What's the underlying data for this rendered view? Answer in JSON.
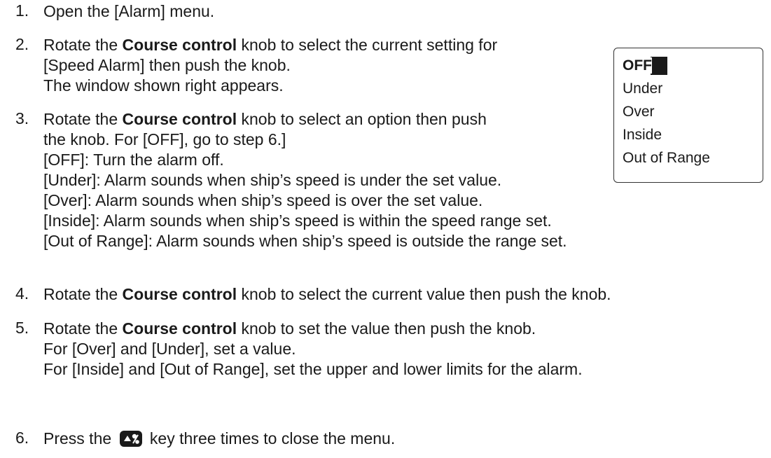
{
  "steps": [
    {
      "num": "1.",
      "lines": [
        "Open the [Alarm] menu."
      ]
    },
    {
      "num": "2.",
      "a": "Rotate the ",
      "bold": "Course control",
      "b": " knob to select the current setting for",
      "lines": [
        "[Speed Alarm] then push the knob.",
        "The window shown right appears."
      ]
    },
    {
      "num": "3.",
      "a": "Rotate the ",
      "bold": "Course control",
      "b": " knob to select an option then push",
      "lines": [
        "the knob. For [OFF], go to step 6.]",
        "[OFF]: Turn the alarm off.",
        "[Under]: Alarm sounds when ship’s speed is under the set value.",
        "[Over]: Alarm sounds when ship’s speed is over the set value.",
        "[Inside]: Alarm sounds when ship’s speed is within the speed range set.",
        "[Out of Range]: Alarm sounds when ship’s speed is outside the range set."
      ]
    },
    {
      "num": "4.",
      "a": "Rotate the ",
      "bold": "Course control",
      "b": " knob to select the current value then push the knob.",
      "lines": []
    },
    {
      "num": "5.",
      "a": "Rotate the ",
      "bold": "Course control",
      "b": " knob to set the value then push the knob.",
      "lines": [
        "For [Over] and [Under], set a value.",
        "For [Inside] and [Out of Range], set the upper and lower limits for the alarm."
      ]
    },
    {
      "num": "6.",
      "a": "Press the ",
      "b": " key three times to close the menu.",
      "icon": "menu-esc-key-icon"
    }
  ],
  "popup": {
    "options": [
      "OFF",
      "Under",
      "Over",
      "Inside",
      "Out of Range"
    ],
    "selected": "OFF"
  }
}
